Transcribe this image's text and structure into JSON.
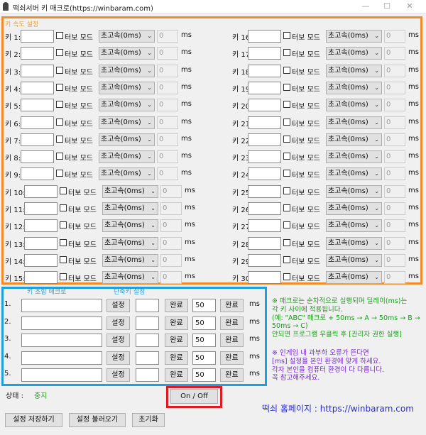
{
  "window": {
    "title": "떡쇠서버 키 매크로(https://winbaram.com)",
    "minimize": "—",
    "maximize": "☐",
    "close": "✕"
  },
  "speed_panel": {
    "title": "키 속도 설정",
    "turbo_label": "터보 모드",
    "select_value": "초고속(0ms)",
    "ms_value": "0",
    "ms_unit": "ms",
    "keys": [
      "키 1:",
      "키 2:",
      "키 3:",
      "키 4:",
      "키 5:",
      "키 6:",
      "키 7:",
      "키 8:",
      "키 9:",
      "키 10:",
      "키 11:",
      "키 12:",
      "키 13:",
      "키 14:",
      "키 15:",
      "키 16:",
      "키 17:",
      "키 18:",
      "키 19:",
      "키 20:",
      "키 21:",
      "키 22:",
      "키 23:",
      "키 24:",
      "키 25:",
      "키 26:",
      "키 27:",
      "키 28:",
      "키 29:",
      "키 30:"
    ]
  },
  "macro_panel": {
    "combo_header": "키 조합 매크로",
    "hotkey_header": "단축키 설정",
    "set_label": "설정",
    "done_label": "완료",
    "delay_value": "50",
    "ms_unit": "ms",
    "rows": [
      "1.",
      "2.",
      "3.",
      "4.",
      "5."
    ]
  },
  "notes": {
    "green": [
      "※ 매크로는 순차적으로 실행되며 딜레이(ms)는",
      "각 키 사이에 적용됩니다.",
      "(예: \"ABC\" 매크로 + 50ms → A → 50ms → B →",
      "50ms → C)",
      "안되면 프로그램 우클릭 후 [관리자 권한 실행]"
    ],
    "purple": [
      "※ 인게임 내 과부하 오류가 뜬다면",
      "[ms] 설정을 본인 환경에 맞게 하세요.",
      "각자 본인을 컴퓨터 환경이 다 다릅니다.",
      "꼭 참고해주세요."
    ]
  },
  "status": {
    "label": "상태 :",
    "value": "중지"
  },
  "onoff_label": "On / Off",
  "bottom": {
    "save": "설정 저장하기",
    "load": "설정 불러오기",
    "reset": "초기화"
  },
  "homepage": "떡쇠 홈페이지 : https://winbaram.com",
  "colors": {
    "speed_border": "#f28c28",
    "macro_border": "#1ea0dc",
    "onoff_border": "#e01a22",
    "green_text": "#1a9e1a",
    "purple_text": "#7a28d6",
    "link": "#2a2ad6"
  }
}
